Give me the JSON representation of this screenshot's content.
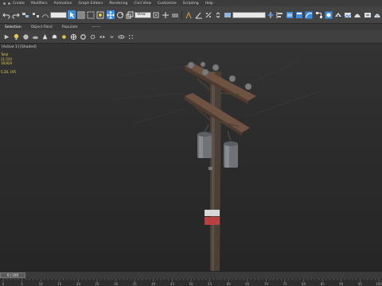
{
  "menu": {
    "items": [
      "Create",
      "Modifiers",
      "Animation",
      "Graph Editors",
      "Rendering",
      "Civil View",
      "Customize",
      "Scripting",
      "Help"
    ]
  },
  "toolbar": {
    "selection_filter": "",
    "reference_coord": "View",
    "named_selection": "",
    "icons": [
      "undo-icon",
      "redo-icon",
      "link-icon",
      "unlink-icon",
      "bind-space-warp-icon",
      "selection-filter",
      "select-object-icon",
      "select-by-name-icon",
      "rect-region-icon",
      "window-crossing-icon",
      "move-icon",
      "rotate-icon",
      "scale-icon",
      "ref-coord-select",
      "pivot-center-icon",
      "select-manipulate-icon",
      "keyboard-shortcut-icon",
      "snap-toggle-icon",
      "angle-snap-icon",
      "percent-snap-icon",
      "spinner-snap-icon",
      "named-selection-icon",
      "named-selection-select",
      "mirror-icon",
      "align-icon",
      "layer-manager-icon",
      "ribbon-toggle-icon",
      "curve-editor-icon",
      "schematic-view-icon",
      "material-editor-icon",
      "render-setup-icon",
      "rendered-frame-icon",
      "render-production-icon",
      "render-iterative-icon",
      "activeshade-icon"
    ]
  },
  "ribbon_tabs": {
    "tabs": [
      "Selection",
      "Object Paint",
      "Populate"
    ]
  },
  "viewport": {
    "label": "[Active 1] [Shaded]",
    "stats": [
      "Total",
      "21,534",
      "18,828",
      "",
      "5,28, 195"
    ]
  },
  "timeline": {
    "frame_indicator": "0 / 100",
    "ticks": [
      "0",
      "5",
      "10",
      "15",
      "20",
      "25",
      "30",
      "35",
      "40",
      "45",
      "50",
      "55",
      "60",
      "65",
      "70",
      "75",
      "80",
      "85",
      "90",
      "95",
      "100"
    ]
  },
  "colors": {
    "accent_blue": "#3a8ee6",
    "stats_yellow": "#e6c84a",
    "viewport_bg": "#2b2b2b"
  }
}
